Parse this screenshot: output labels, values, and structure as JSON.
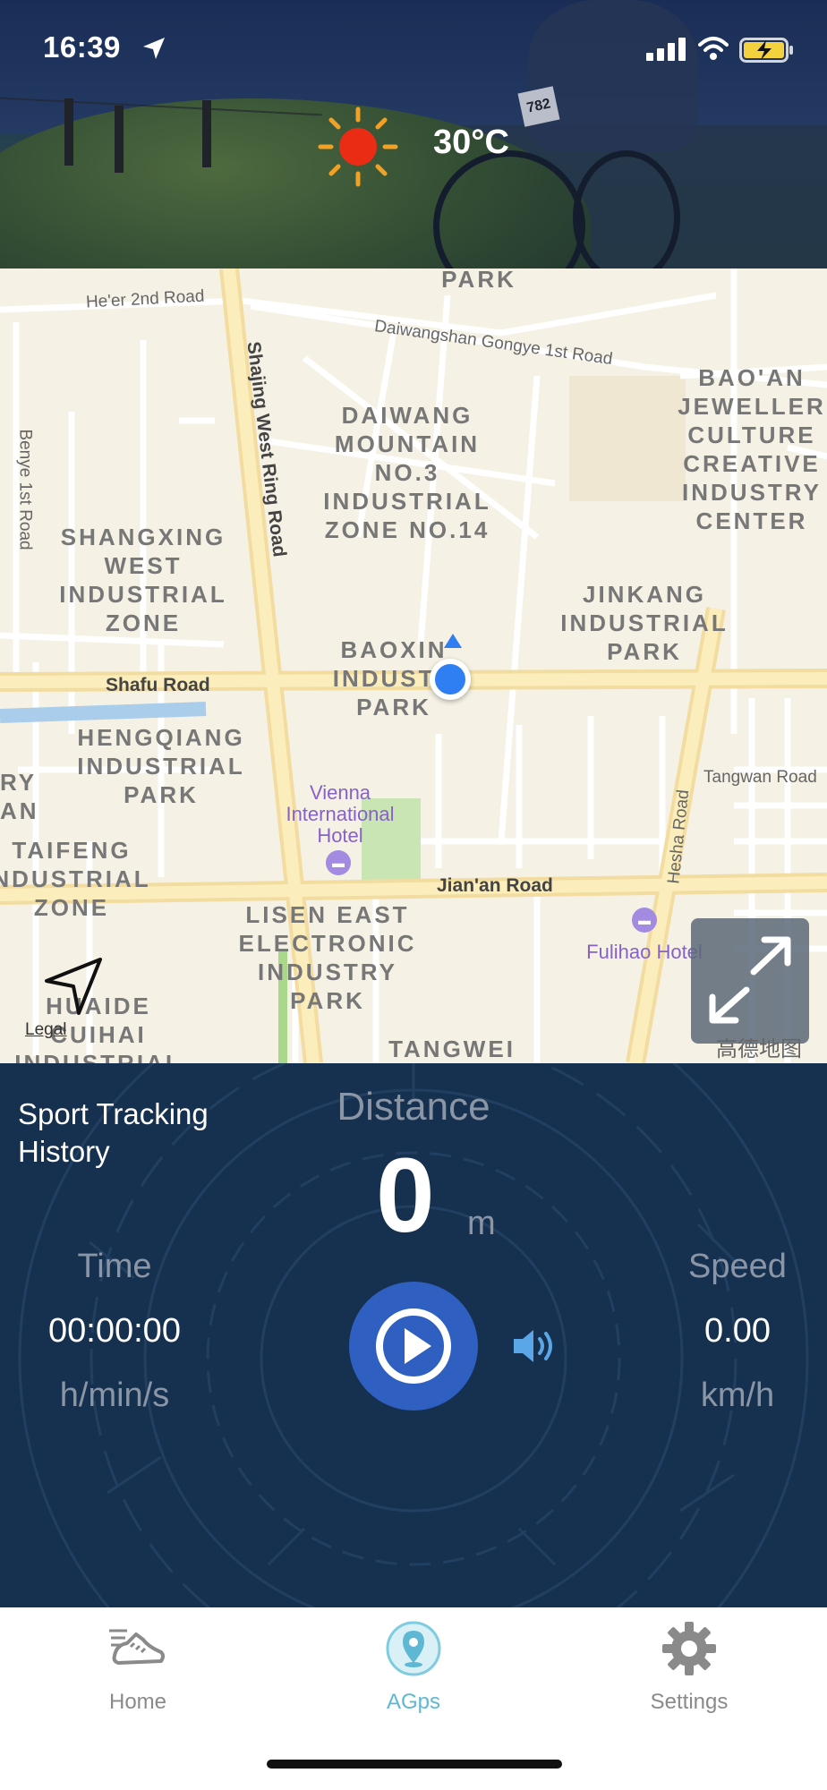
{
  "status_bar": {
    "time": "16:39",
    "icons": [
      "location-arrow-icon",
      "cellular-signal-icon",
      "wifi-icon",
      "battery-charging-icon"
    ]
  },
  "weather": {
    "icon": "sun-icon",
    "temperature": "30°C"
  },
  "map": {
    "area_labels": [
      "PARK",
      "DAIWANG\nMOUNTAIN\nNO.3\nINDUSTRIAL\nZONE NO.14",
      "BAO'AN\nJEWELLER\nCULTURE\nCREATIVE\nINDUSTRY\nCENTER",
      "SHANGXING\nWEST\nINDUSTRIAL\nZONE",
      "JINKANG\nINDUSTRIAL\nPARK",
      "BAOXIN\nINDUSTR\nPARK",
      "HENGQIANG\nINDUSTRIAL\nPARK",
      "RY\nAN",
      "TAIFENG\nNDUSTRIAL\nZONE",
      "LISEN EAST\nELECTRONIC\nINDUSTRY\nPARK",
      "HUAIDE\nCUIHAI\nINDUSTRIAL",
      "TANGWEI"
    ],
    "road_labels": [
      "He'er 2nd Road",
      "Daiwangshan Gongye 1st Road",
      "Shajing West Ring Road",
      "Benye 1st Road",
      "Shafu Road",
      "Tangwan Road",
      "Hesha Road",
      "Jian'an Road"
    ],
    "pois": [
      {
        "name": "Vienna\nInternational\nHotel",
        "icon": "hotel-icon"
      },
      {
        "name": "Fulihao Hotel",
        "icon": "hotel-icon"
      }
    ],
    "legal": "Legal",
    "provider": "高德地图"
  },
  "tracking": {
    "history_label": "Sport Tracking\nHistory",
    "distance_label": "Distance",
    "distance_value": "0",
    "distance_unit": "m",
    "time_label": "Time",
    "time_value": "00:00:00",
    "time_unit": "h/min/s",
    "speed_label": "Speed",
    "speed_value": "0.00",
    "speed_unit": "km/h"
  },
  "tabs": [
    {
      "label": "Home",
      "icon": "running-shoe-icon",
      "active": false
    },
    {
      "label": "AGps",
      "icon": "map-pin-icon",
      "active": true
    },
    {
      "label": "Settings",
      "icon": "gear-icon",
      "active": false
    }
  ],
  "colors": {
    "panel_bg": "#16304f",
    "accent": "#5fb8d3",
    "play_button": "#2f5fc0",
    "user_location": "#2f7ef2"
  }
}
